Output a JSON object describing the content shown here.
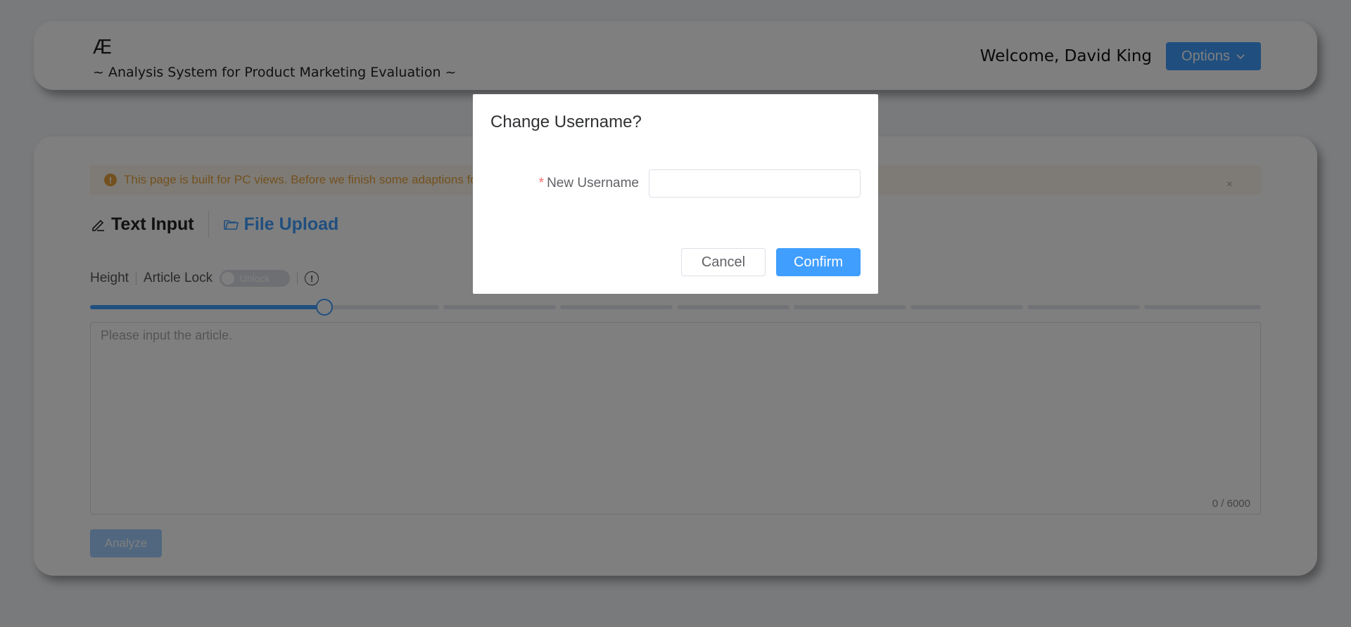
{
  "header": {
    "logo": "Æ",
    "subtitle": "~ Analysis System for Product Marketing Evaluation ~",
    "welcome": "Welcome, David King",
    "options_label": "Options"
  },
  "alert": {
    "message": "This page is built for PC views. Before we finish some adaptions for mobile, please use PC to access this page.",
    "close": "×"
  },
  "tabs": [
    {
      "label": "Text Input",
      "icon": "edit-icon"
    },
    {
      "label": "File Upload",
      "icon": "folder-icon"
    }
  ],
  "controls": {
    "height_label": "Height",
    "lock_label": "Article Lock",
    "switch_text": "Unlock",
    "info_icon": "!"
  },
  "slider": {
    "value_fraction": 0.2
  },
  "textarea": {
    "placeholder": "Please input the article.",
    "counter": "0 / 6000"
  },
  "analyze_label": "Analyze",
  "dialog": {
    "title": "Change Username?",
    "field_label": "New Username",
    "required_mark": "*",
    "cancel": "Cancel",
    "confirm": "Confirm"
  },
  "colors": {
    "primary": "#409eff",
    "warning": "#e6a23c",
    "danger": "#f56c6c"
  }
}
